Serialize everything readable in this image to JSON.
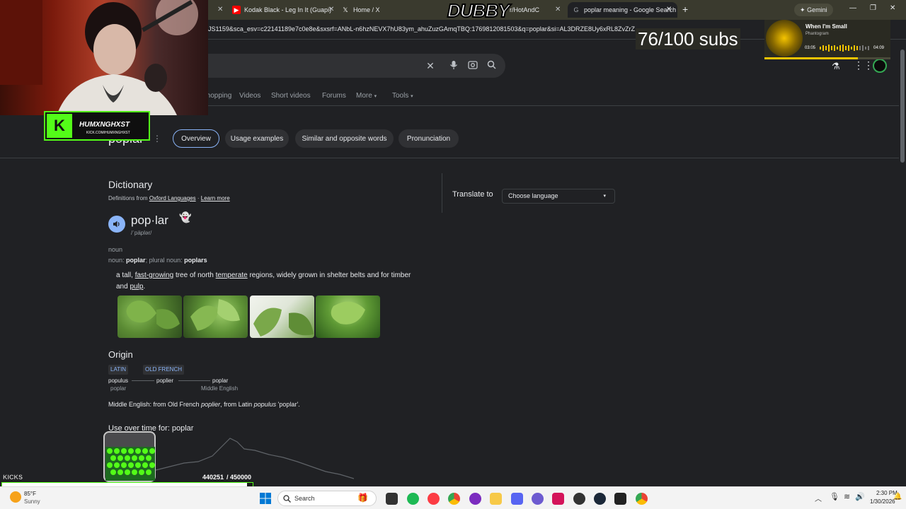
{
  "browser": {
    "tabs": [
      {
        "label": "Kodak Black - Leg In It (Guapi)",
        "icon": "youtube-icon"
      },
      {
        "label": "Home / X",
        "icon": "x-icon"
      },
      {
        "label": "r/HotAndC",
        "icon": "reddit-icon"
      },
      {
        "label": "poplar meaning - Google Search",
        "icon": "google-icon"
      }
    ],
    "new_tab": "+",
    "gemini_label": "Gemini",
    "url": "JS1159&sca_esv=c22141189e7c0e8e&sxsrf=ANbL-n6hzNEVX7hU83ym_ahuZuzGAmqTBQ:1769812081503&q=poplar&si=AL3DRZE8Uy6xRL8ZvZrZ"
  },
  "overlays": {
    "dubby_text": "DUBBY",
    "subs_text": "76/100 subs",
    "streamer_name": "HUMXNGHXST",
    "streamer_url": "KICK.COM/HUMXNGHXST",
    "music": {
      "title": "When I'm Small",
      "artist": "Phantogram",
      "elapsed": "03:05",
      "total": "04:09",
      "progress": 0.74
    },
    "kicks_label": "KICKS",
    "kicks_count": "440251",
    "kicks_goal": "/ 450000",
    "kicks_progress": 0.978
  },
  "search": {
    "nav_tabs": [
      "Shopping",
      "Videos",
      "Short videos",
      "Forums",
      "More",
      "Tools"
    ],
    "query_title": "poplar",
    "chips": [
      "Overview",
      "Usage examples",
      "Similar and opposite words",
      "Pronunciation"
    ]
  },
  "dictionary": {
    "heading": "Dictionary",
    "source_prefix": "Definitions from",
    "source_name": "Oxford Languages",
    "learn_more": "Learn more",
    "word": "pop·lar",
    "phonetic": "/ˈpäplər/",
    "pos": "noun",
    "forms_prefix": "noun:",
    "forms_word": "poplar",
    "forms_plural_prefix": "; plural noun:",
    "forms_plural": "poplars",
    "definition_parts": [
      "a tall,",
      "fast-growing",
      "tree of north",
      "temperate",
      "regions, widely grown in shelter belts and for",
      "timber and",
      "pulp",
      "."
    ],
    "origin_heading": "Origin",
    "origin_tags": [
      "LATIN",
      "OLD FRENCH"
    ],
    "origin_chain": [
      {
        "word": "populus",
        "sub": "poplar"
      },
      {
        "word": "poplier",
        "sub": ""
      },
      {
        "word": "poplar",
        "sub": "Middle English"
      }
    ],
    "etymology": [
      "Middle English: from Old French",
      "poplier",
      ", from Latin",
      "populus",
      "'poplar'."
    ],
    "use_over_time": "Use over time for: poplar"
  },
  "translate": {
    "label": "Translate to",
    "select_value": "Choose language"
  },
  "taskbar": {
    "weather_temp": "85°F",
    "weather_desc": "Sunny",
    "search_placeholder": "Search",
    "time": "2:30 PM",
    "date": "1/30/2026"
  },
  "colors": {
    "google_dark": "#202124",
    "chip_accent": "#8ab4f8",
    "kicks_green": "#53fc18",
    "music_gold": "#f5c400"
  }
}
